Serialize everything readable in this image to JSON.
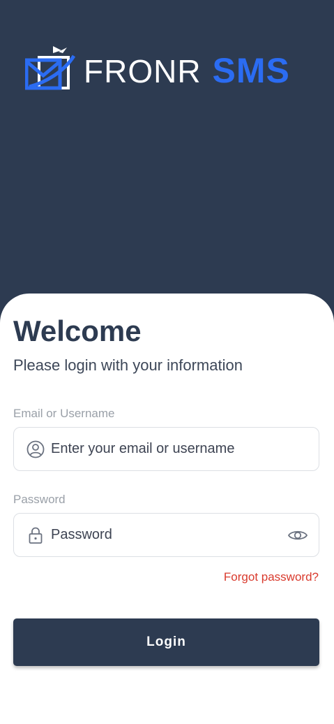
{
  "logo": {
    "brand_main": "FRONR",
    "brand_accent": "SMS",
    "icon": "envelope-send-icon",
    "accent_color": "#2b6cf2"
  },
  "card": {
    "title": "Welcome",
    "subtitle": "Please login with your information"
  },
  "email_field": {
    "label": "Email or Username",
    "placeholder": "Enter your email or username",
    "icon": "user-circle-icon"
  },
  "password_field": {
    "label": "Password",
    "placeholder": "Password",
    "icon": "lock-icon",
    "toggle_icon": "eye-icon"
  },
  "forgot_link": "Forgot password?",
  "login_button": "Login",
  "colors": {
    "primary": "#2d3b51",
    "link": "#d93a2d",
    "background": "#ffffff"
  }
}
